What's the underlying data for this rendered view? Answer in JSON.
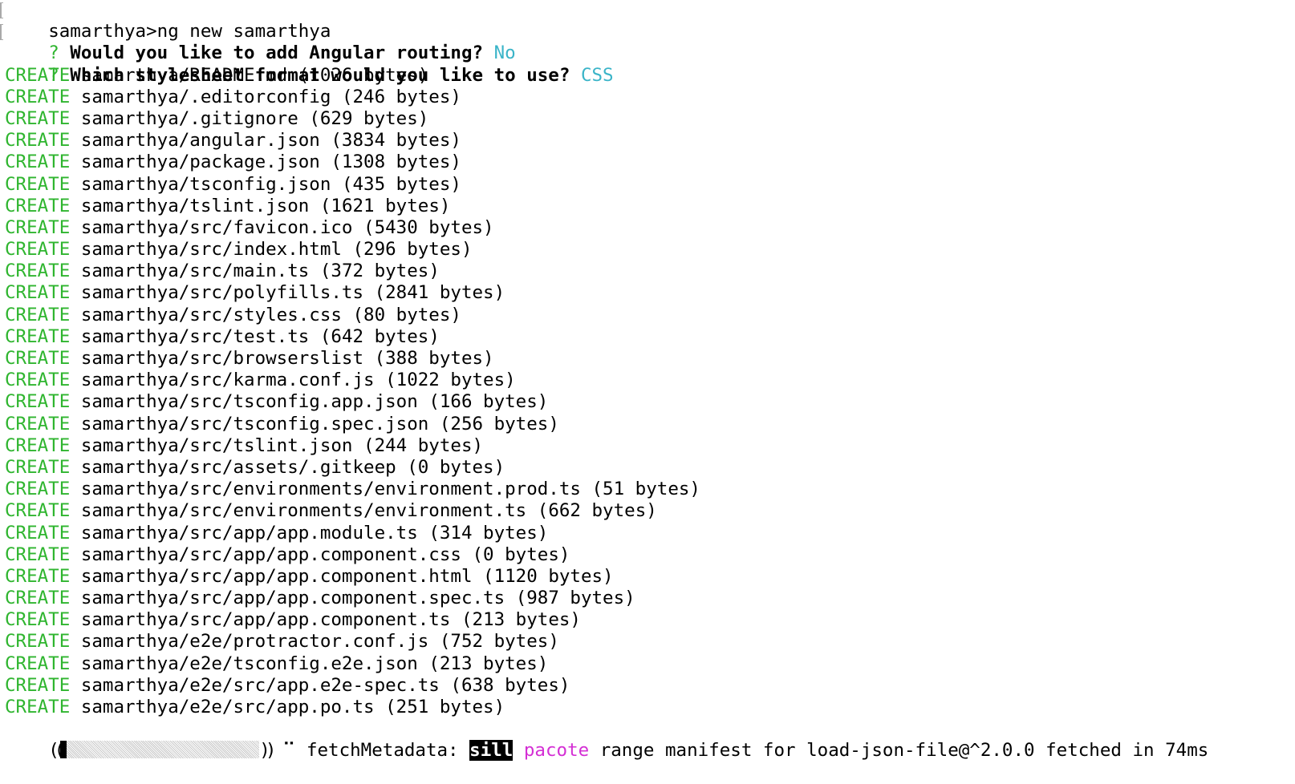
{
  "terminal": {
    "command_line": {
      "prompt": "samarthya>",
      "command": "ng new samarthya"
    },
    "questions": [
      {
        "marker": "?",
        "question": "Would you like to add Angular routing?",
        "answer": "No"
      },
      {
        "marker": "?",
        "question": "Which stylesheet format would you like to use?",
        "answer": "CSS"
      }
    ],
    "create_label": "CREATE",
    "created_files": [
      {
        "path": "samarthya/README.md",
        "size": "(1026 bytes)"
      },
      {
        "path": "samarthya/.editorconfig",
        "size": "(246 bytes)"
      },
      {
        "path": "samarthya/.gitignore",
        "size": "(629 bytes)"
      },
      {
        "path": "samarthya/angular.json",
        "size": "(3834 bytes)"
      },
      {
        "path": "samarthya/package.json",
        "size": "(1308 bytes)"
      },
      {
        "path": "samarthya/tsconfig.json",
        "size": "(435 bytes)"
      },
      {
        "path": "samarthya/tslint.json",
        "size": "(1621 bytes)"
      },
      {
        "path": "samarthya/src/favicon.ico",
        "size": "(5430 bytes)"
      },
      {
        "path": "samarthya/src/index.html",
        "size": "(296 bytes)"
      },
      {
        "path": "samarthya/src/main.ts",
        "size": "(372 bytes)"
      },
      {
        "path": "samarthya/src/polyfills.ts",
        "size": "(2841 bytes)"
      },
      {
        "path": "samarthya/src/styles.css",
        "size": "(80 bytes)"
      },
      {
        "path": "samarthya/src/test.ts",
        "size": "(642 bytes)"
      },
      {
        "path": "samarthya/src/browserslist",
        "size": "(388 bytes)"
      },
      {
        "path": "samarthya/src/karma.conf.js",
        "size": "(1022 bytes)"
      },
      {
        "path": "samarthya/src/tsconfig.app.json",
        "size": "(166 bytes)"
      },
      {
        "path": "samarthya/src/tsconfig.spec.json",
        "size": "(256 bytes)"
      },
      {
        "path": "samarthya/src/tslint.json",
        "size": "(244 bytes)"
      },
      {
        "path": "samarthya/src/assets/.gitkeep",
        "size": "(0 bytes)"
      },
      {
        "path": "samarthya/src/environments/environment.prod.ts",
        "size": "(51 bytes)"
      },
      {
        "path": "samarthya/src/environments/environment.ts",
        "size": "(662 bytes)"
      },
      {
        "path": "samarthya/src/app/app.module.ts",
        "size": "(314 bytes)"
      },
      {
        "path": "samarthya/src/app/app.component.css",
        "size": "(0 bytes)"
      },
      {
        "path": "samarthya/src/app/app.component.html",
        "size": "(1120 bytes)"
      },
      {
        "path": "samarthya/src/app/app.component.spec.ts",
        "size": "(987 bytes)"
      },
      {
        "path": "samarthya/src/app/app.component.ts",
        "size": "(213 bytes)"
      },
      {
        "path": "samarthya/e2e/protractor.conf.js",
        "size": "(752 bytes)"
      },
      {
        "path": "samarthya/e2e/tsconfig.e2e.json",
        "size": "(213 bytes)"
      },
      {
        "path": "samarthya/e2e/src/app.e2e-spec.ts",
        "size": "(638 bytes)"
      },
      {
        "path": "samarthya/e2e/src/app.po.ts",
        "size": "(251 bytes)"
      }
    ],
    "status_line": {
      "open_paren": "((",
      "close_paren": "))",
      "progress_fraction": 0.03,
      "spinner": "⠉",
      "task": "fetchMetadata:",
      "level": "sill",
      "module": "pacote",
      "message": "range manifest for load-json-file@^2.0.0 fetched in 74ms"
    }
  },
  "colors": {
    "create": "#2fb52f",
    "answer": "#3ab4c8",
    "module": "#d42fd4"
  }
}
